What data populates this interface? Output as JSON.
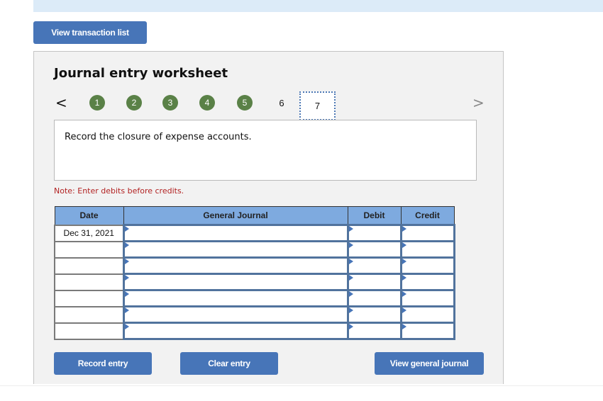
{
  "header": {
    "view_transaction_list_label": "View transaction list"
  },
  "worksheet": {
    "title": "Journal entry worksheet",
    "nav": {
      "prev_icon": "chevron-left-icon",
      "next_icon": "chevron-right-icon",
      "prev_glyph": "<",
      "next_glyph": ">",
      "completed_steps": [
        "1",
        "2",
        "3",
        "4",
        "5"
      ],
      "other_steps": [
        "6"
      ],
      "current_step": "7",
      "completed_color": "#5a8147"
    },
    "instruction": "Record the closure of expense accounts.",
    "note": "Note: Enter debits before credits.",
    "table": {
      "columns": [
        "Date",
        "General Journal",
        "Debit",
        "Credit"
      ],
      "rows": [
        {
          "date": "Dec 31, 2021",
          "account": "",
          "debit": "",
          "credit": ""
        },
        {
          "date": "",
          "account": "",
          "debit": "",
          "credit": ""
        },
        {
          "date": "",
          "account": "",
          "debit": "",
          "credit": ""
        },
        {
          "date": "",
          "account": "",
          "debit": "",
          "credit": ""
        },
        {
          "date": "",
          "account": "",
          "debit": "",
          "credit": ""
        },
        {
          "date": "",
          "account": "",
          "debit": "",
          "credit": ""
        },
        {
          "date": "",
          "account": "",
          "debit": "",
          "credit": ""
        }
      ]
    },
    "buttons": {
      "record": "Record entry",
      "clear": "Clear entry",
      "view_general_journal": "View general journal"
    }
  },
  "colors": {
    "button": "#4775b8",
    "header_fill": "#7eaadf",
    "note": "#b22222"
  }
}
